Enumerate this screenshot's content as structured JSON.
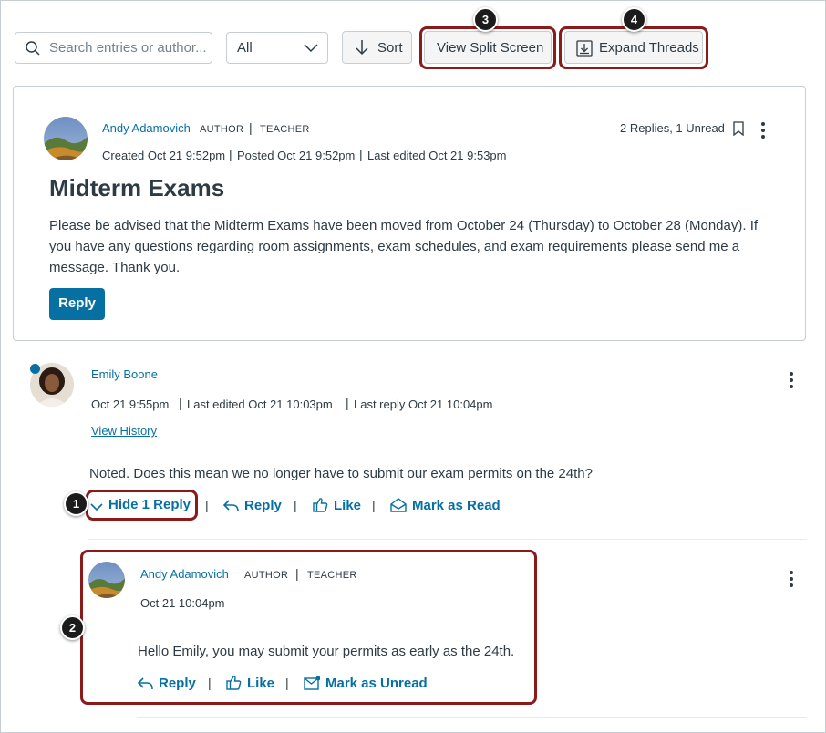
{
  "toolbar": {
    "search_placeholder": "Search entries or author...",
    "filter_value": "All",
    "sort_label": "Sort",
    "split_label": "View Split Screen",
    "expand_label": "Expand Threads"
  },
  "callouts": {
    "c1": "1",
    "c2": "2",
    "c3": "3",
    "c4": "4"
  },
  "post": {
    "author": "Andy Adamovich",
    "role1": "AUTHOR",
    "role2": "TEACHER",
    "meta_created": "Created Oct 21 9:52pm",
    "meta_posted": "Posted Oct 21 9:52pm",
    "meta_edited": "Last edited Oct 21 9:53pm",
    "replies_summary": "2 Replies, 1 Unread",
    "title": "Midterm Exams",
    "body": "Please be advised that the Midterm Exams have been moved from October 24 (Thursday) to October 28 (Monday). If you have any questions regarding room assignments, exam schedules, and exam requirements please send me a message. Thank you.",
    "reply_label": "Reply"
  },
  "entry": {
    "author": "Emily Boone",
    "meta_date": "Oct 21 9:55pm",
    "meta_edited": "Last edited Oct 21 10:03pm",
    "meta_last_reply": "Last reply Oct 21 10:04pm",
    "history_link": "View History",
    "body": "Noted. Does this mean we no longer have to submit our exam permits on the 24th?",
    "hide_label": "Hide 1 Reply",
    "reply_label": "Reply",
    "like_label": "Like",
    "mark_label": "Mark as Read"
  },
  "reply": {
    "author": "Andy Adamovich",
    "role1": "AUTHOR",
    "role2": "TEACHER",
    "date": "Oct 21 10:04pm",
    "body": "Hello Emily, you may submit your permits as early as the 24th.",
    "reply_label": "Reply",
    "like_label": "Like",
    "mark_label": "Mark as Unread"
  },
  "colors": {
    "link": "#0770a3",
    "callout_border": "#8b1a1a",
    "unread_dot": "#0770a3"
  },
  "icons": [
    "search-icon",
    "chevron-down-icon",
    "arrow-down-icon",
    "expand-download-icon",
    "bookmark-icon",
    "more-vertical-icon",
    "reply-arrow-icon",
    "thumbs-up-icon",
    "envelope-open-icon",
    "envelope-closed-icon"
  ]
}
